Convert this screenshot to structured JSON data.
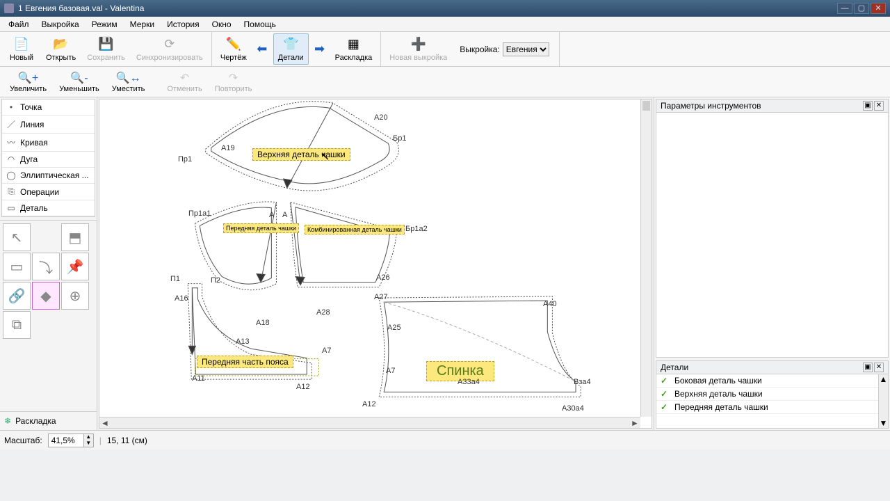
{
  "window": {
    "title": "1 Евгения базовая.val - Valentina"
  },
  "menu": {
    "file": "Файл",
    "pattern": "Выкройка",
    "mode": "Режим",
    "measurements": "Мерки",
    "history": "История",
    "window": "Окно",
    "help": "Помощь"
  },
  "toolbar": {
    "new": "Новый",
    "open": "Открыть",
    "save": "Сохранить",
    "sync": "Синхронизировать",
    "draw": "Чертёж",
    "details": "Детали",
    "layout": "Раскладка",
    "new_pattern": "Новая выкройка",
    "pattern_label": "Выкройка:",
    "pattern_value": "Евгения"
  },
  "viewbar": {
    "zoom_in": "Увеличить",
    "zoom_out": "Уменьшить",
    "fit": "Уместить",
    "undo": "Отменить",
    "redo": "Повторить"
  },
  "tools": {
    "point": "Точка",
    "line": "Линия",
    "curve": "Кривая",
    "arc": "Дуга",
    "elliptical": "Эллиптическая ...",
    "operations": "Операции",
    "detail": "Деталь",
    "layout_btn": "Раскладка"
  },
  "right": {
    "props_title": "Параметры инструментов",
    "details_title": "Детали",
    "items": [
      "Боковая деталь чашки",
      "Верхняя деталь чашки",
      "Передняя деталь чашки"
    ]
  },
  "status": {
    "scale_label": "Масштаб:",
    "scale_value": "41,5%",
    "coords": "15, 11 (см)"
  },
  "labels": {
    "A20": "A20",
    "Бр1": "Бр1",
    "A19": "A19",
    "Пр1": "Пр1",
    "upper_cup": "Верхняя деталь чашки",
    "Пр1а1": "Пр1а1",
    "A": "A",
    "A_2": "A",
    "Бр1а2": "Бр1а2",
    "front_cup_sm": "Передняя деталь чашки",
    "side_cup_sm": "Комбинированная деталь чашки",
    "П1": "П1",
    "П2": "П2",
    "A16": "A16",
    "A18": "A18",
    "A28": "A28",
    "A26": "A26",
    "A13": "A13",
    "A7": "A7",
    "A7_2": "A7",
    "front_belt": "Передняя часть пояса",
    "A11": "A11",
    "A12": "A12",
    "A12_2": "A12",
    "A27": "A27",
    "A25": "A25",
    "back": "Спинка",
    "A33a4": "A33a4",
    "A40": "A40",
    "Вза4": "Вза4",
    "A30a4": "A30a4"
  }
}
